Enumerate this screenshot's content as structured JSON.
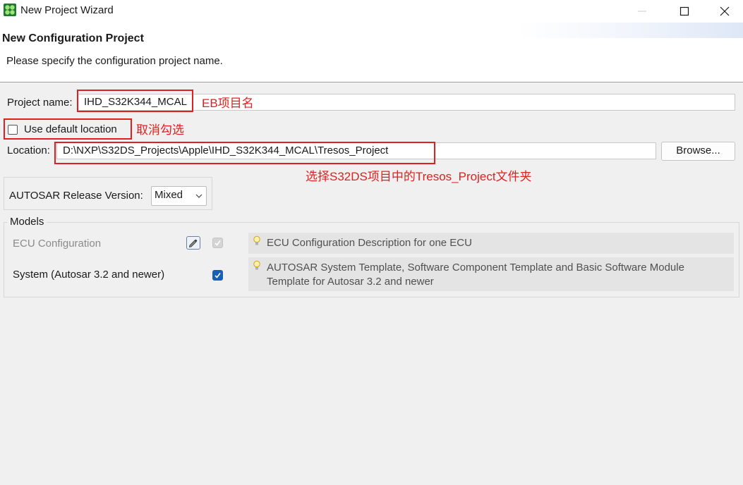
{
  "window": {
    "title": "New Project Wizard"
  },
  "header": {
    "title": "New Configuration Project",
    "description": "Please specify the configuration project name."
  },
  "project_name": {
    "label": "Project name:",
    "value": "IHD_S32K344_MCAL"
  },
  "default_location": {
    "label": "Use default location",
    "checked": false
  },
  "location": {
    "label": "Location:",
    "value": "D:\\NXP\\S32DS_Projects\\Apple\\IHD_S32K344_MCAL\\Tresos_Project",
    "browse_label": "Browse..."
  },
  "autosar": {
    "label": "AUTOSAR Release Version:",
    "selected": "Mixed"
  },
  "models": {
    "title": "Models",
    "items": [
      {
        "name": "ECU Configuration",
        "enabled": false,
        "checked": true,
        "description": "ECU Configuration Description for one ECU"
      },
      {
        "name": "System (Autosar 3.2 and newer)",
        "enabled": true,
        "checked": true,
        "description": "AUTOSAR System Template, Software Component Template and Basic Software Module Template for Autosar 3.2 and newer"
      }
    ]
  },
  "annotations": {
    "project_name_note": "EB项目名",
    "checkbox_note": "取消勾选",
    "location_note": "选择S32DS项目中的Tresos_Project文件夹"
  },
  "colors": {
    "annotation": "#e02020",
    "checkbox_checked": "#1a5fb4"
  }
}
